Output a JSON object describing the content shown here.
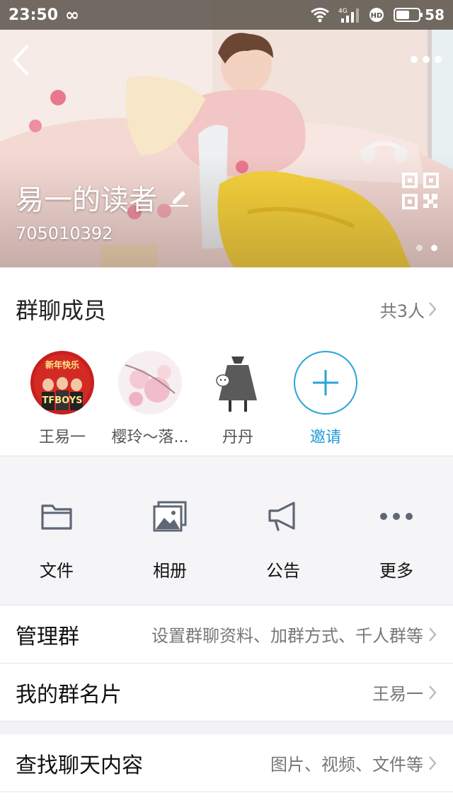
{
  "status_bar": {
    "time": "23:50",
    "infinity": "∞",
    "network": "4G",
    "hd": "HD",
    "battery_percent": "58",
    "battery_level": 0.58
  },
  "header": {
    "group_name": "易一的读者",
    "group_id": "705010392",
    "page_count": 2,
    "active_page": 2
  },
  "members": {
    "title": "群聊成员",
    "count_label": "共3人",
    "list": [
      {
        "name": "王易一",
        "avatar_text": "新年快乐",
        "avatar_text2": "TFBOYS"
      },
      {
        "name": "樱玲～落..."
      },
      {
        "name": "丹丹"
      }
    ],
    "invite_label": "邀请"
  },
  "actions": [
    {
      "label": "文件",
      "icon": "folder-icon"
    },
    {
      "label": "相册",
      "icon": "album-icon"
    },
    {
      "label": "公告",
      "icon": "megaphone-icon"
    },
    {
      "label": "更多",
      "icon": "more-icon"
    }
  ],
  "rows": {
    "manage": {
      "title": "管理群",
      "value": "设置群聊资料、加群方式、千人群等"
    },
    "card": {
      "title": "我的群名片",
      "value": "王易一"
    },
    "search": {
      "title": "查找聊天内容",
      "value": "图片、视频、文件等"
    }
  },
  "colors": {
    "accent": "#1e9bd6",
    "icon_gray": "#5f6675",
    "background_gray": "#f5f5f7"
  }
}
